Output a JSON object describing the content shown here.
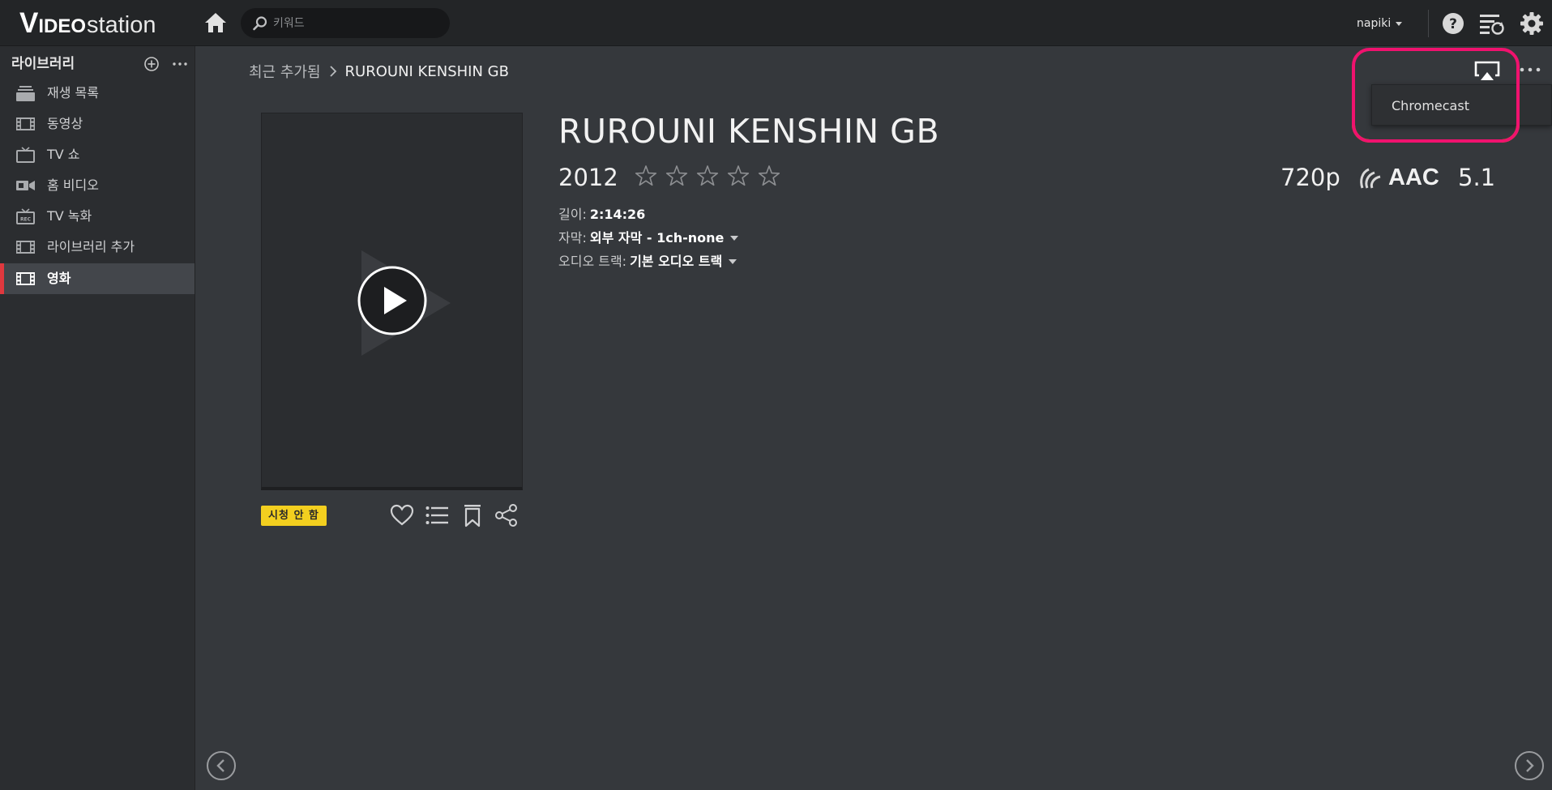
{
  "app": {
    "logo_v": "V",
    "logo_ideo": "IDEO",
    "logo_station": "station"
  },
  "topbar": {
    "search_placeholder": "키워드",
    "username": "napiki",
    "icons": [
      "home-icon",
      "search-icon",
      "help-icon",
      "task-list-icon",
      "settings-icon"
    ]
  },
  "sidebar": {
    "title": "라이브러리",
    "items": [
      {
        "label": "재생 목록",
        "icon": "playlist-icon",
        "active": false
      },
      {
        "label": "동영상",
        "icon": "film-icon",
        "active": false
      },
      {
        "label": "TV 쇼",
        "icon": "tv-icon",
        "active": false
      },
      {
        "label": "홈 비디오",
        "icon": "camcorder-icon",
        "active": false
      },
      {
        "label": "TV 녹화",
        "icon": "tv-recording-icon",
        "active": false
      },
      {
        "label": "라이브러리 추가",
        "icon": "film-icon",
        "active": false
      },
      {
        "label": "영화",
        "icon": "film-icon",
        "active": true
      }
    ]
  },
  "breadcrumb": {
    "parent": "최근 추가됨",
    "current": "RUROUNI KENSHIN GB"
  },
  "movie": {
    "title": "RUROUNI KENSHIN GB",
    "year": "2012",
    "rating": 0,
    "rating_max": 5,
    "resolution": "720p",
    "audio_codec": "AAC",
    "channels": "5.1",
    "duration_label": "길이:",
    "duration": "2:14:26",
    "subtitle_label": "자막:",
    "subtitle": "외부 자막 - 1ch-none",
    "audio_track_label": "오디오 트랙:",
    "audio_track": "기본 오디오 트랙",
    "watch_status": "시청 안 함"
  },
  "cast_menu": {
    "items": [
      "Chromecast"
    ]
  },
  "colors": {
    "accent_red": "#e0383e",
    "badge_yellow": "#f3cf1f",
    "highlight_pink": "#f0126e",
    "highlight_orange": "#ff9a00"
  }
}
